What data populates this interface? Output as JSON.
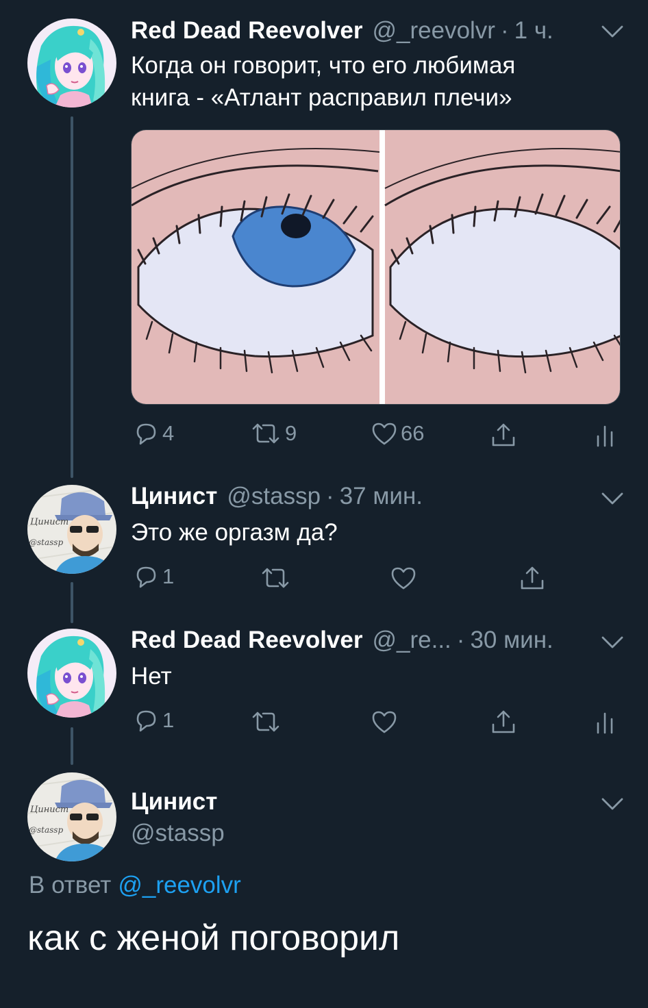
{
  "colors": {
    "background": "#15202b",
    "secondary_text": "#8899a6",
    "link": "#1da1f2",
    "thread_line": "#3d5466"
  },
  "tweets": [
    {
      "name": "Red Dead Reevolver",
      "handle": "@_reevolvr",
      "dot": "·",
      "time": "1 ч.",
      "text_lines": [
        "Когда он говорит, что его любимая",
        "книга - «Атлант расправил плечи»"
      ],
      "media": "two-panel eye meme: iris visible, then eye rolled back",
      "reply_count": "4",
      "retweet_count": "9",
      "like_count": "66"
    },
    {
      "name": "Цинист",
      "handle": "@stassp",
      "dot": "·",
      "time": "37 мин.",
      "text": "Это же оргазм да?",
      "reply_count": "1"
    },
    {
      "name": "Red Dead Reevolver",
      "handle": "@_re...",
      "dot": "·",
      "time": "30 мин.",
      "text": "Нет",
      "reply_count": "1"
    }
  ],
  "main_tweet": {
    "name": "Цинист",
    "handle": "@stassp",
    "reply_to_label": "В ответ",
    "reply_to_handle": "@_reevolvr",
    "text": "как с женой поговорил"
  },
  "icons": [
    "reply-icon",
    "retweet-icon",
    "like-icon",
    "share-icon",
    "analytics-icon",
    "chevron-down-icon"
  ]
}
